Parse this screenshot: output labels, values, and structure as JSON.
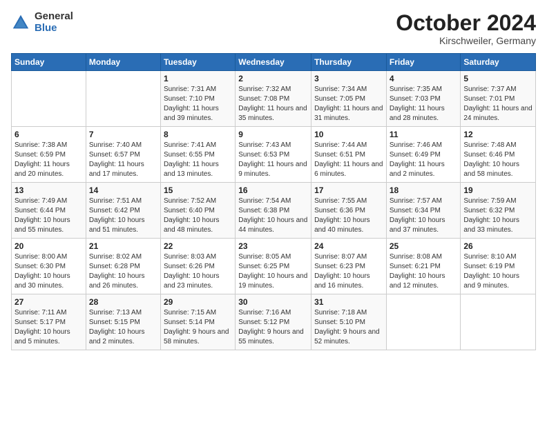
{
  "logo": {
    "general": "General",
    "blue": "Blue"
  },
  "title": "October 2024",
  "location": "Kirschweiler, Germany",
  "days_of_week": [
    "Sunday",
    "Monday",
    "Tuesday",
    "Wednesday",
    "Thursday",
    "Friday",
    "Saturday"
  ],
  "weeks": [
    [
      {
        "day": "",
        "info": ""
      },
      {
        "day": "",
        "info": ""
      },
      {
        "day": "1",
        "info": "Sunrise: 7:31 AM\nSunset: 7:10 PM\nDaylight: 11 hours and 39 minutes."
      },
      {
        "day": "2",
        "info": "Sunrise: 7:32 AM\nSunset: 7:08 PM\nDaylight: 11 hours and 35 minutes."
      },
      {
        "day": "3",
        "info": "Sunrise: 7:34 AM\nSunset: 7:05 PM\nDaylight: 11 hours and 31 minutes."
      },
      {
        "day": "4",
        "info": "Sunrise: 7:35 AM\nSunset: 7:03 PM\nDaylight: 11 hours and 28 minutes."
      },
      {
        "day": "5",
        "info": "Sunrise: 7:37 AM\nSunset: 7:01 PM\nDaylight: 11 hours and 24 minutes."
      }
    ],
    [
      {
        "day": "6",
        "info": "Sunrise: 7:38 AM\nSunset: 6:59 PM\nDaylight: 11 hours and 20 minutes."
      },
      {
        "day": "7",
        "info": "Sunrise: 7:40 AM\nSunset: 6:57 PM\nDaylight: 11 hours and 17 minutes."
      },
      {
        "day": "8",
        "info": "Sunrise: 7:41 AM\nSunset: 6:55 PM\nDaylight: 11 hours and 13 minutes."
      },
      {
        "day": "9",
        "info": "Sunrise: 7:43 AM\nSunset: 6:53 PM\nDaylight: 11 hours and 9 minutes."
      },
      {
        "day": "10",
        "info": "Sunrise: 7:44 AM\nSunset: 6:51 PM\nDaylight: 11 hours and 6 minutes."
      },
      {
        "day": "11",
        "info": "Sunrise: 7:46 AM\nSunset: 6:49 PM\nDaylight: 11 hours and 2 minutes."
      },
      {
        "day": "12",
        "info": "Sunrise: 7:48 AM\nSunset: 6:46 PM\nDaylight: 10 hours and 58 minutes."
      }
    ],
    [
      {
        "day": "13",
        "info": "Sunrise: 7:49 AM\nSunset: 6:44 PM\nDaylight: 10 hours and 55 minutes."
      },
      {
        "day": "14",
        "info": "Sunrise: 7:51 AM\nSunset: 6:42 PM\nDaylight: 10 hours and 51 minutes."
      },
      {
        "day": "15",
        "info": "Sunrise: 7:52 AM\nSunset: 6:40 PM\nDaylight: 10 hours and 48 minutes."
      },
      {
        "day": "16",
        "info": "Sunrise: 7:54 AM\nSunset: 6:38 PM\nDaylight: 10 hours and 44 minutes."
      },
      {
        "day": "17",
        "info": "Sunrise: 7:55 AM\nSunset: 6:36 PM\nDaylight: 10 hours and 40 minutes."
      },
      {
        "day": "18",
        "info": "Sunrise: 7:57 AM\nSunset: 6:34 PM\nDaylight: 10 hours and 37 minutes."
      },
      {
        "day": "19",
        "info": "Sunrise: 7:59 AM\nSunset: 6:32 PM\nDaylight: 10 hours and 33 minutes."
      }
    ],
    [
      {
        "day": "20",
        "info": "Sunrise: 8:00 AM\nSunset: 6:30 PM\nDaylight: 10 hours and 30 minutes."
      },
      {
        "day": "21",
        "info": "Sunrise: 8:02 AM\nSunset: 6:28 PM\nDaylight: 10 hours and 26 minutes."
      },
      {
        "day": "22",
        "info": "Sunrise: 8:03 AM\nSunset: 6:26 PM\nDaylight: 10 hours and 23 minutes."
      },
      {
        "day": "23",
        "info": "Sunrise: 8:05 AM\nSunset: 6:25 PM\nDaylight: 10 hours and 19 minutes."
      },
      {
        "day": "24",
        "info": "Sunrise: 8:07 AM\nSunset: 6:23 PM\nDaylight: 10 hours and 16 minutes."
      },
      {
        "day": "25",
        "info": "Sunrise: 8:08 AM\nSunset: 6:21 PM\nDaylight: 10 hours and 12 minutes."
      },
      {
        "day": "26",
        "info": "Sunrise: 8:10 AM\nSunset: 6:19 PM\nDaylight: 10 hours and 9 minutes."
      }
    ],
    [
      {
        "day": "27",
        "info": "Sunrise: 7:11 AM\nSunset: 5:17 PM\nDaylight: 10 hours and 5 minutes."
      },
      {
        "day": "28",
        "info": "Sunrise: 7:13 AM\nSunset: 5:15 PM\nDaylight: 10 hours and 2 minutes."
      },
      {
        "day": "29",
        "info": "Sunrise: 7:15 AM\nSunset: 5:14 PM\nDaylight: 9 hours and 58 minutes."
      },
      {
        "day": "30",
        "info": "Sunrise: 7:16 AM\nSunset: 5:12 PM\nDaylight: 9 hours and 55 minutes."
      },
      {
        "day": "31",
        "info": "Sunrise: 7:18 AM\nSunset: 5:10 PM\nDaylight: 9 hours and 52 minutes."
      },
      {
        "day": "",
        "info": ""
      },
      {
        "day": "",
        "info": ""
      }
    ]
  ]
}
